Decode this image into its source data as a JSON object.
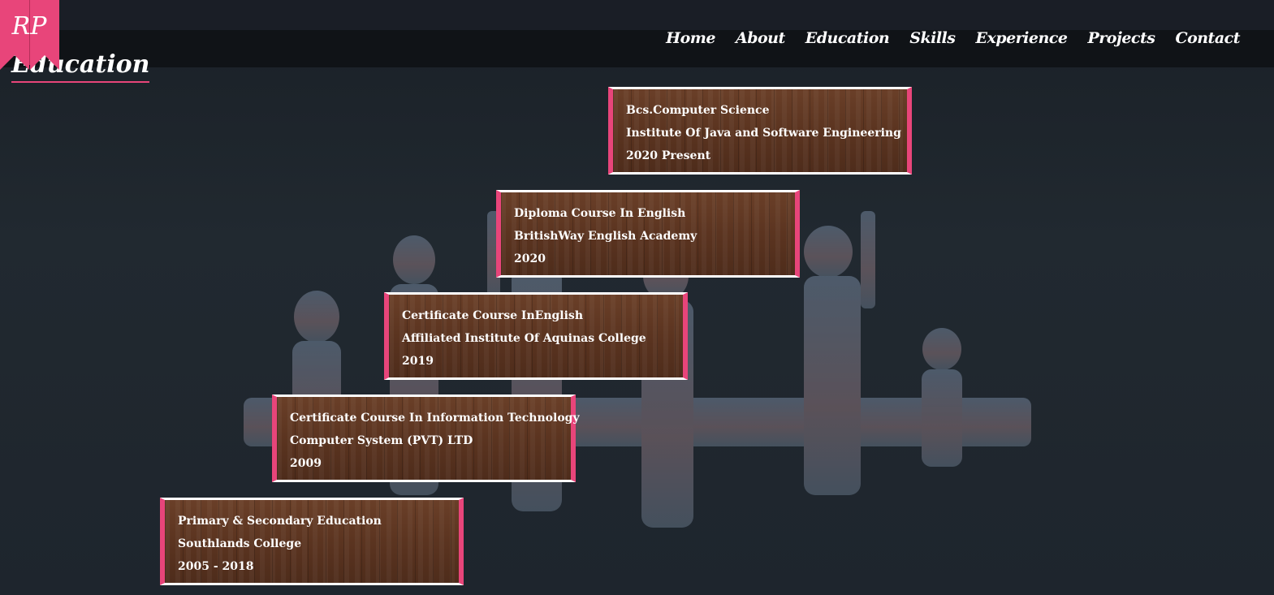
{
  "logo": {
    "text": "RP"
  },
  "nav": {
    "items": [
      "Home",
      "About",
      "Education",
      "Skills",
      "Experience",
      "Projects",
      "Contact"
    ]
  },
  "section": {
    "title": "Education"
  },
  "education": [
    {
      "title": "Bcs.Computer Science",
      "institution": "Institute Of Java and Software Engineering",
      "period": "2020 Present"
    },
    {
      "title": "Diploma Course In English",
      "institution": "BritishWay English Academy",
      "period": "2020"
    },
    {
      "title": "Certificate Course InEnglish",
      "institution": "Affiliated Institute Of Aquinas College",
      "period": "2019"
    },
    {
      "title": "Certificate Course In Information Technology",
      "institution": "Computer System (PVT) LTD",
      "period": "2009"
    },
    {
      "title": "Primary & Secondary Education",
      "institution": "Southlands College",
      "period": "2005 - 2018"
    }
  ],
  "colors": {
    "accent": "#e8457a",
    "background": "#1f262e",
    "navbar": "#101317",
    "card_wood": "#5b3420"
  }
}
